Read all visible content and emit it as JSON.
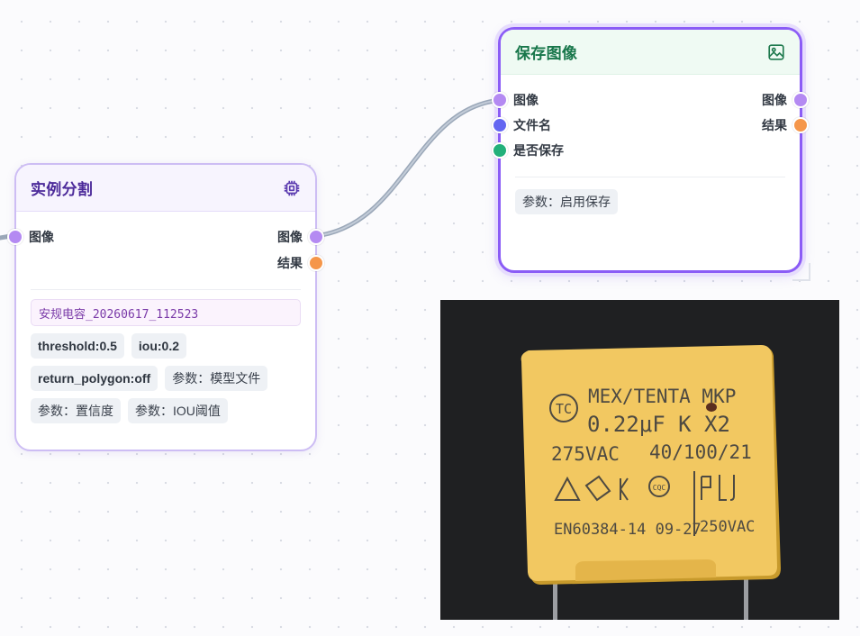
{
  "nodes": {
    "instance_seg": {
      "title": "实例分割",
      "icon": "chip-icon",
      "inputs": [
        {
          "label": "图像",
          "color": "#b48af2"
        }
      ],
      "outputs": [
        {
          "label": "图像",
          "color": "#b48af2"
        },
        {
          "label": "结果",
          "color": "#f5964a"
        }
      ],
      "model_file": "安规电容_20260617_112523",
      "params": [
        "threshold:0.5",
        "iou:0.2",
        "return_polygon:off",
        "参数：模型文件",
        "参数：置信度",
        "参数：IOU阈值"
      ]
    },
    "save_image": {
      "title": "保存图像",
      "icon": "image-icon",
      "inputs": [
        {
          "label": "图像",
          "color": "#b48af2"
        },
        {
          "label": "文件名",
          "color": "#6366f1"
        },
        {
          "label": "是否保存",
          "color": "#22b07a"
        }
      ],
      "outputs": [
        {
          "label": "图像",
          "color": "#b48af2"
        },
        {
          "label": "结果",
          "color": "#f5964a"
        }
      ],
      "params": [
        "参数：启用保存"
      ]
    }
  },
  "preview": {
    "capacitor_text": {
      "line1": "MEX/TENTA MKP",
      "line2": "0.22μF K X2",
      "line3a": "275VAC",
      "line3b": "40/100/21",
      "line5a": "EN60384-14 09-27",
      "line5b": "250VAC",
      "logo_tc": "TC",
      "logo_cqc": "CQC"
    }
  },
  "colors": {
    "accent_purple": "#8b5cf6",
    "title_purple": "#4c2a9a",
    "title_green": "#17764a",
    "wire": "#9aa7b8"
  }
}
